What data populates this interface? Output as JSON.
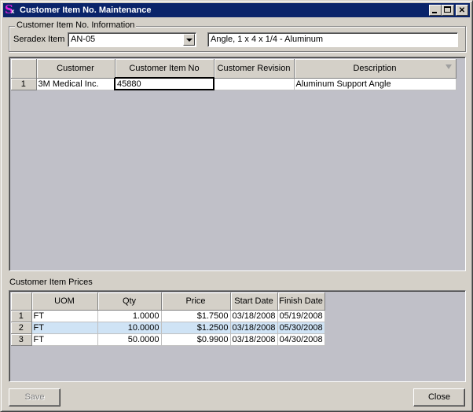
{
  "window": {
    "title": "Customer Item No. Maintenance",
    "icon": "sx-app-icon",
    "controls": [
      "minimize",
      "maximize",
      "close"
    ]
  },
  "info_group": {
    "legend": "Customer Item No. Information",
    "seradex_label": "Seradex Item :",
    "seradex_value": "AN-05",
    "description_value": "Angle, 1 x 4 x 1/4 - Aluminum"
  },
  "customer_grid": {
    "columns": [
      "",
      "Customer",
      "Customer Item No",
      "Customer Revision",
      "Description"
    ],
    "rows": [
      {
        "num": "1",
        "customer": "3M Medical Inc.",
        "item_no": "45880",
        "revision": "",
        "description": "Aluminum Support Angle"
      }
    ]
  },
  "prices": {
    "label": "Customer Item Prices",
    "columns": [
      "",
      "UOM",
      "Qty",
      "Price",
      "Start Date",
      "Finish Date"
    ],
    "rows": [
      {
        "num": "1",
        "uom": "FT",
        "qty": "1.0000",
        "price": "$1.7500",
        "start": "03/18/2008",
        "finish": "05/19/2008"
      },
      {
        "num": "2",
        "uom": "FT",
        "qty": "10.0000",
        "price": "$1.2500",
        "start": "03/18/2008",
        "finish": "05/30/2008"
      },
      {
        "num": "3",
        "uom": "FT",
        "qty": "50.0000",
        "price": "$0.9900",
        "start": "03/18/2008",
        "finish": "04/30/2008"
      }
    ],
    "selected_row": 2
  },
  "buttons": {
    "save": "Save",
    "close": "Close"
  },
  "colors": {
    "titlebar": "#0a246a",
    "selection": "#cfe3f5",
    "grid_bg": "#c0c0c8"
  }
}
